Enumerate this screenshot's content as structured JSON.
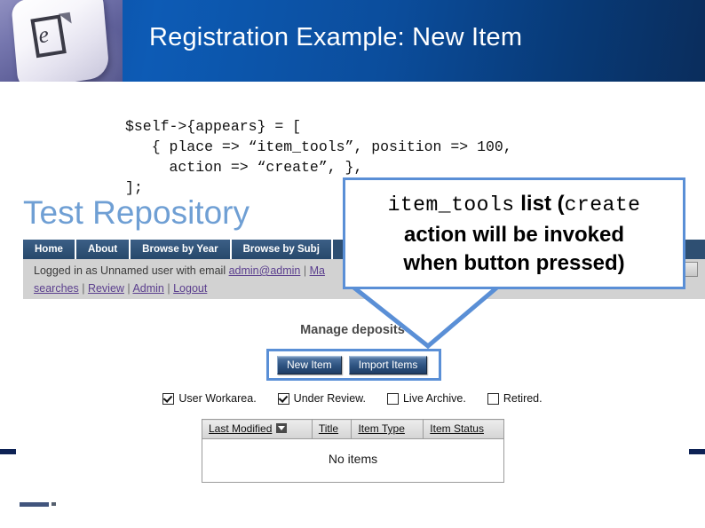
{
  "slide": {
    "title": "Registration Example: New Item",
    "logo_icon": "eprints-key-icon",
    "logo_letter": "e"
  },
  "code": {
    "text": "$self->{appears} = [\n   { place => “item_tools”, position => 100,\n     action => “create”, },\n];"
  },
  "callout": {
    "line1_mono_a": "item_tools",
    "line1_bold": " list (",
    "line1_mono_b": "create",
    "line2": "action will be invoked",
    "line3": "when button pressed)",
    "border_color": "#5a8fd6"
  },
  "screenshot": {
    "repository_title": "Test Repository",
    "nav_tabs": [
      {
        "label": "Home"
      },
      {
        "label": "About"
      },
      {
        "label": "Browse by Year"
      },
      {
        "label": "Browse by Subj"
      }
    ],
    "login_bar": {
      "prefix": "Logged in as Unnamed user with email ",
      "email": "admin@admin",
      "sep": " | ",
      "truncated": "Ma",
      "links": [
        {
          "label": "searches"
        },
        {
          "label": "Review"
        },
        {
          "label": "Admin"
        },
        {
          "label": "Logout"
        }
      ]
    },
    "search": {
      "value": "",
      "placeholder": "",
      "button_label": ""
    },
    "manage_heading": "Manage deposits",
    "buttons": [
      {
        "label": "New Item"
      },
      {
        "label": "Import Items"
      }
    ],
    "filters": [
      {
        "label": "User Workarea.",
        "checked": true
      },
      {
        "label": "Under Review.",
        "checked": true
      },
      {
        "label": "Live Archive.",
        "checked": false
      },
      {
        "label": "Retired.",
        "checked": false
      }
    ],
    "table": {
      "columns": [
        {
          "label": "Last Modified",
          "sorted": true,
          "sort_icon": "sort-descending-icon"
        },
        {
          "label": "Title",
          "sorted": false
        },
        {
          "label": "Item Type",
          "sorted": false
        },
        {
          "label": "Item Status",
          "sorted": false
        }
      ],
      "empty_message": "No items"
    }
  }
}
